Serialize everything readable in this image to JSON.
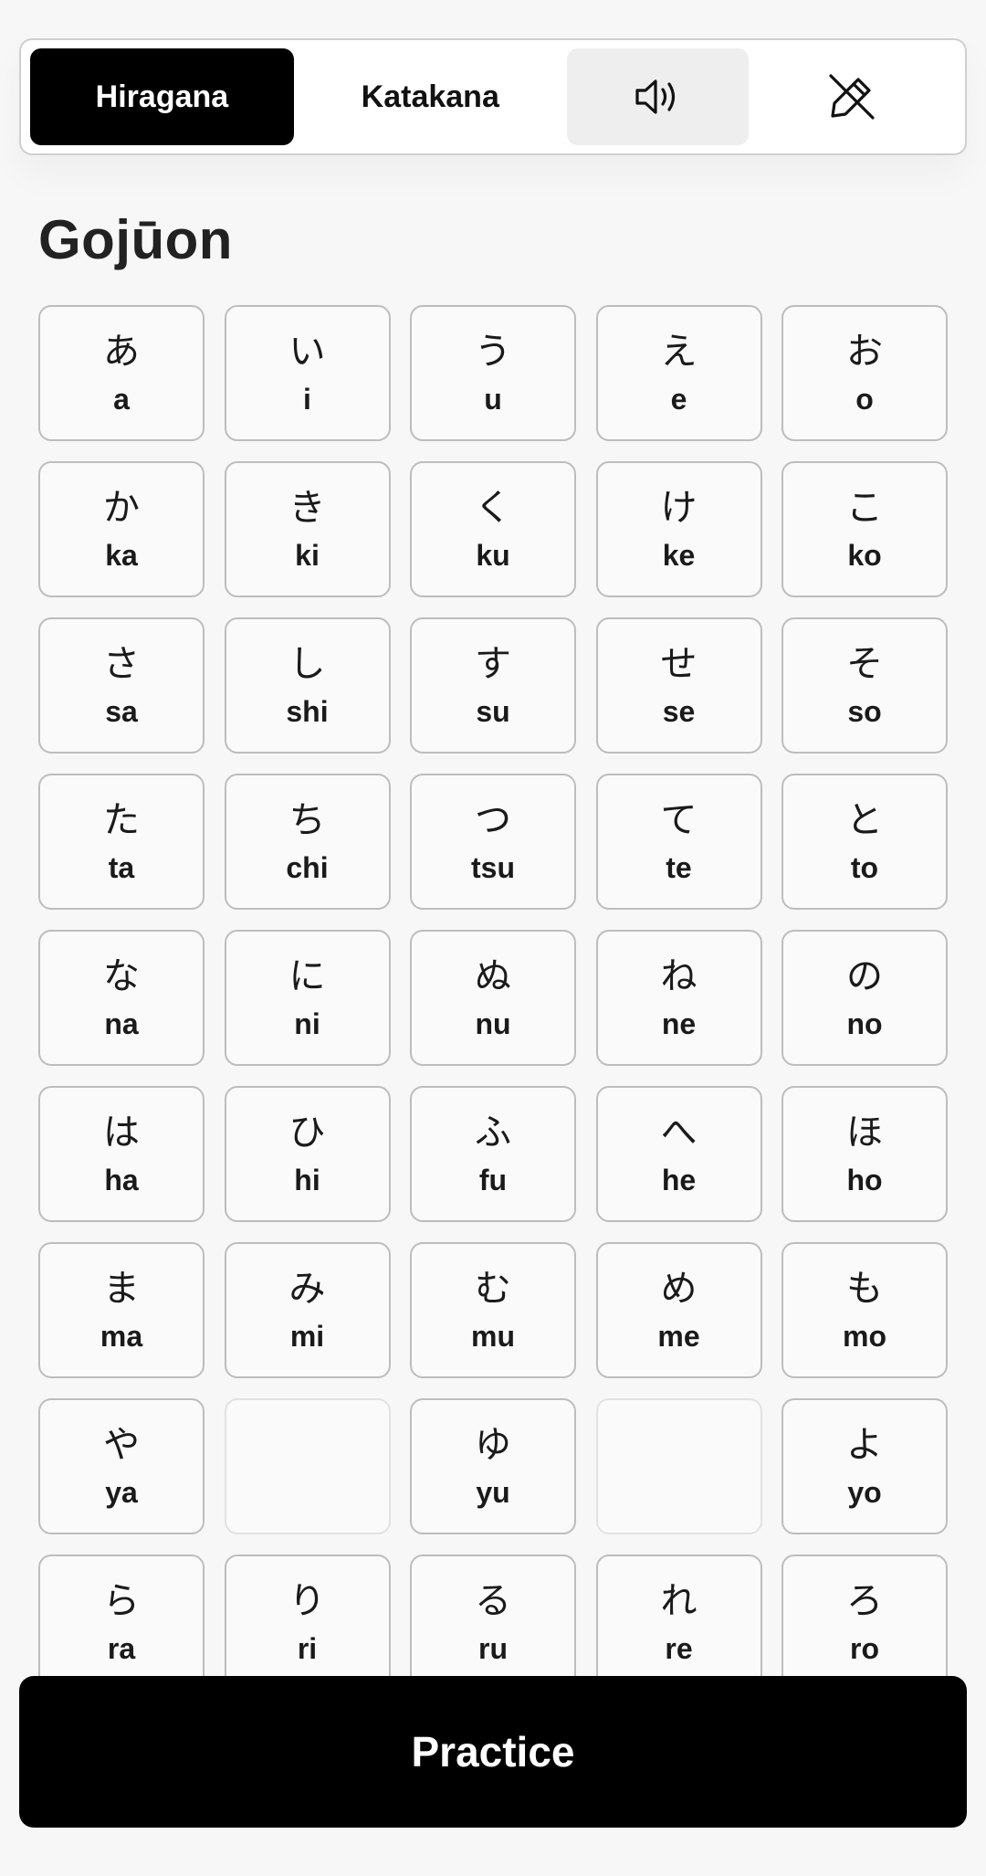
{
  "tabs": {
    "hiragana_label": "Hiragana",
    "katakana_label": "Katakana"
  },
  "icons": {
    "sound": "speaker-icon",
    "pen": "pencil-off-icon"
  },
  "section": {
    "title": "Gojūon"
  },
  "kana_rows": [
    [
      {
        "kana": "あ",
        "romaji": "a"
      },
      {
        "kana": "い",
        "romaji": "i"
      },
      {
        "kana": "う",
        "romaji": "u"
      },
      {
        "kana": "え",
        "romaji": "e"
      },
      {
        "kana": "お",
        "romaji": "o"
      }
    ],
    [
      {
        "kana": "か",
        "romaji": "ka"
      },
      {
        "kana": "き",
        "romaji": "ki"
      },
      {
        "kana": "く",
        "romaji": "ku"
      },
      {
        "kana": "け",
        "romaji": "ke"
      },
      {
        "kana": "こ",
        "romaji": "ko"
      }
    ],
    [
      {
        "kana": "さ",
        "romaji": "sa"
      },
      {
        "kana": "し",
        "romaji": "shi"
      },
      {
        "kana": "す",
        "romaji": "su"
      },
      {
        "kana": "せ",
        "romaji": "se"
      },
      {
        "kana": "そ",
        "romaji": "so"
      }
    ],
    [
      {
        "kana": "た",
        "romaji": "ta"
      },
      {
        "kana": "ち",
        "romaji": "chi"
      },
      {
        "kana": "つ",
        "romaji": "tsu"
      },
      {
        "kana": "て",
        "romaji": "te"
      },
      {
        "kana": "と",
        "romaji": "to"
      }
    ],
    [
      {
        "kana": "な",
        "romaji": "na"
      },
      {
        "kana": "に",
        "romaji": "ni"
      },
      {
        "kana": "ぬ",
        "romaji": "nu"
      },
      {
        "kana": "ね",
        "romaji": "ne"
      },
      {
        "kana": "の",
        "romaji": "no"
      }
    ],
    [
      {
        "kana": "は",
        "romaji": "ha"
      },
      {
        "kana": "ひ",
        "romaji": "hi"
      },
      {
        "kana": "ふ",
        "romaji": "fu"
      },
      {
        "kana": "へ",
        "romaji": "he"
      },
      {
        "kana": "ほ",
        "romaji": "ho"
      }
    ],
    [
      {
        "kana": "ま",
        "romaji": "ma"
      },
      {
        "kana": "み",
        "romaji": "mi"
      },
      {
        "kana": "む",
        "romaji": "mu"
      },
      {
        "kana": "め",
        "romaji": "me"
      },
      {
        "kana": "も",
        "romaji": "mo"
      }
    ],
    [
      {
        "kana": "や",
        "romaji": "ya"
      },
      null,
      {
        "kana": "ゆ",
        "romaji": "yu"
      },
      null,
      {
        "kana": "よ",
        "romaji": "yo"
      }
    ],
    [
      {
        "kana": "ら",
        "romaji": "ra"
      },
      {
        "kana": "り",
        "romaji": "ri"
      },
      {
        "kana": "る",
        "romaji": "ru"
      },
      {
        "kana": "れ",
        "romaji": "re"
      },
      {
        "kana": "ろ",
        "romaji": "ro"
      }
    ]
  ],
  "practice": {
    "label": "Practice"
  },
  "colors": {
    "active_tab": "#000000",
    "sound_tab_bg": "#eeeeee",
    "card_border": "#bdbdbd"
  }
}
